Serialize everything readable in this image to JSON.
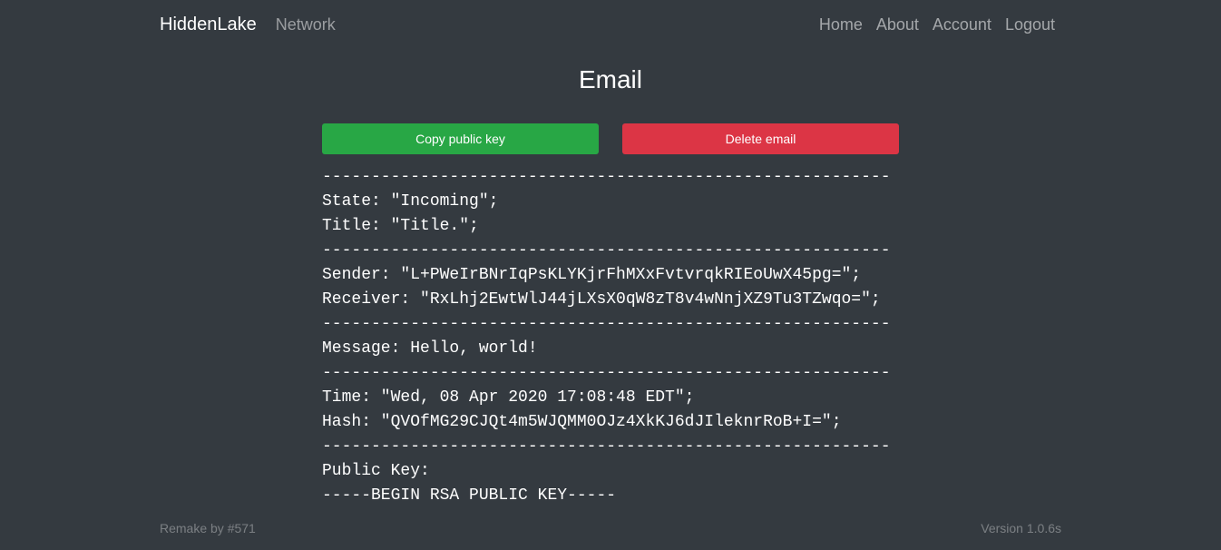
{
  "navbar": {
    "brand": "HiddenLake",
    "network": "Network",
    "links": {
      "home": "Home",
      "about": "About",
      "account": "Account",
      "logout": "Logout"
    }
  },
  "page": {
    "title": "Email"
  },
  "buttons": {
    "copy_public_key": "Copy public key",
    "delete_email": "Delete email"
  },
  "email": {
    "separator": "----------------------------------------------------------",
    "state": "State: \"Incoming\";",
    "title": "Title: \"Title.\";",
    "sender": "Sender: \"L+PWeIrBNrIqPsKLYKjrFhMXxFvtvrqkRIEoUwX45pg=\";",
    "receiver": "Receiver: \"RxLhj2EwtWlJ44jLXsX0qW8zT8v4wNnjXZ9Tu3TZwqo=\";",
    "message": "Message: Hello, world!",
    "time": "Time: \"Wed, 08 Apr 2020 17:08:48 EDT\";",
    "hash": "Hash: \"QVOfMG29CJQt4m5WJQMM0OJz4XkKJ6dJIleknrRoB+I=\";",
    "public_key_label": "Public Key:",
    "public_key_begin": "-----BEGIN RSA PUBLIC KEY-----"
  },
  "footer": {
    "remake": "Remake by #571",
    "version": "Version 1.0.6s"
  },
  "colors": {
    "background": "#343a40",
    "success": "#28a745",
    "danger": "#dc3545"
  }
}
